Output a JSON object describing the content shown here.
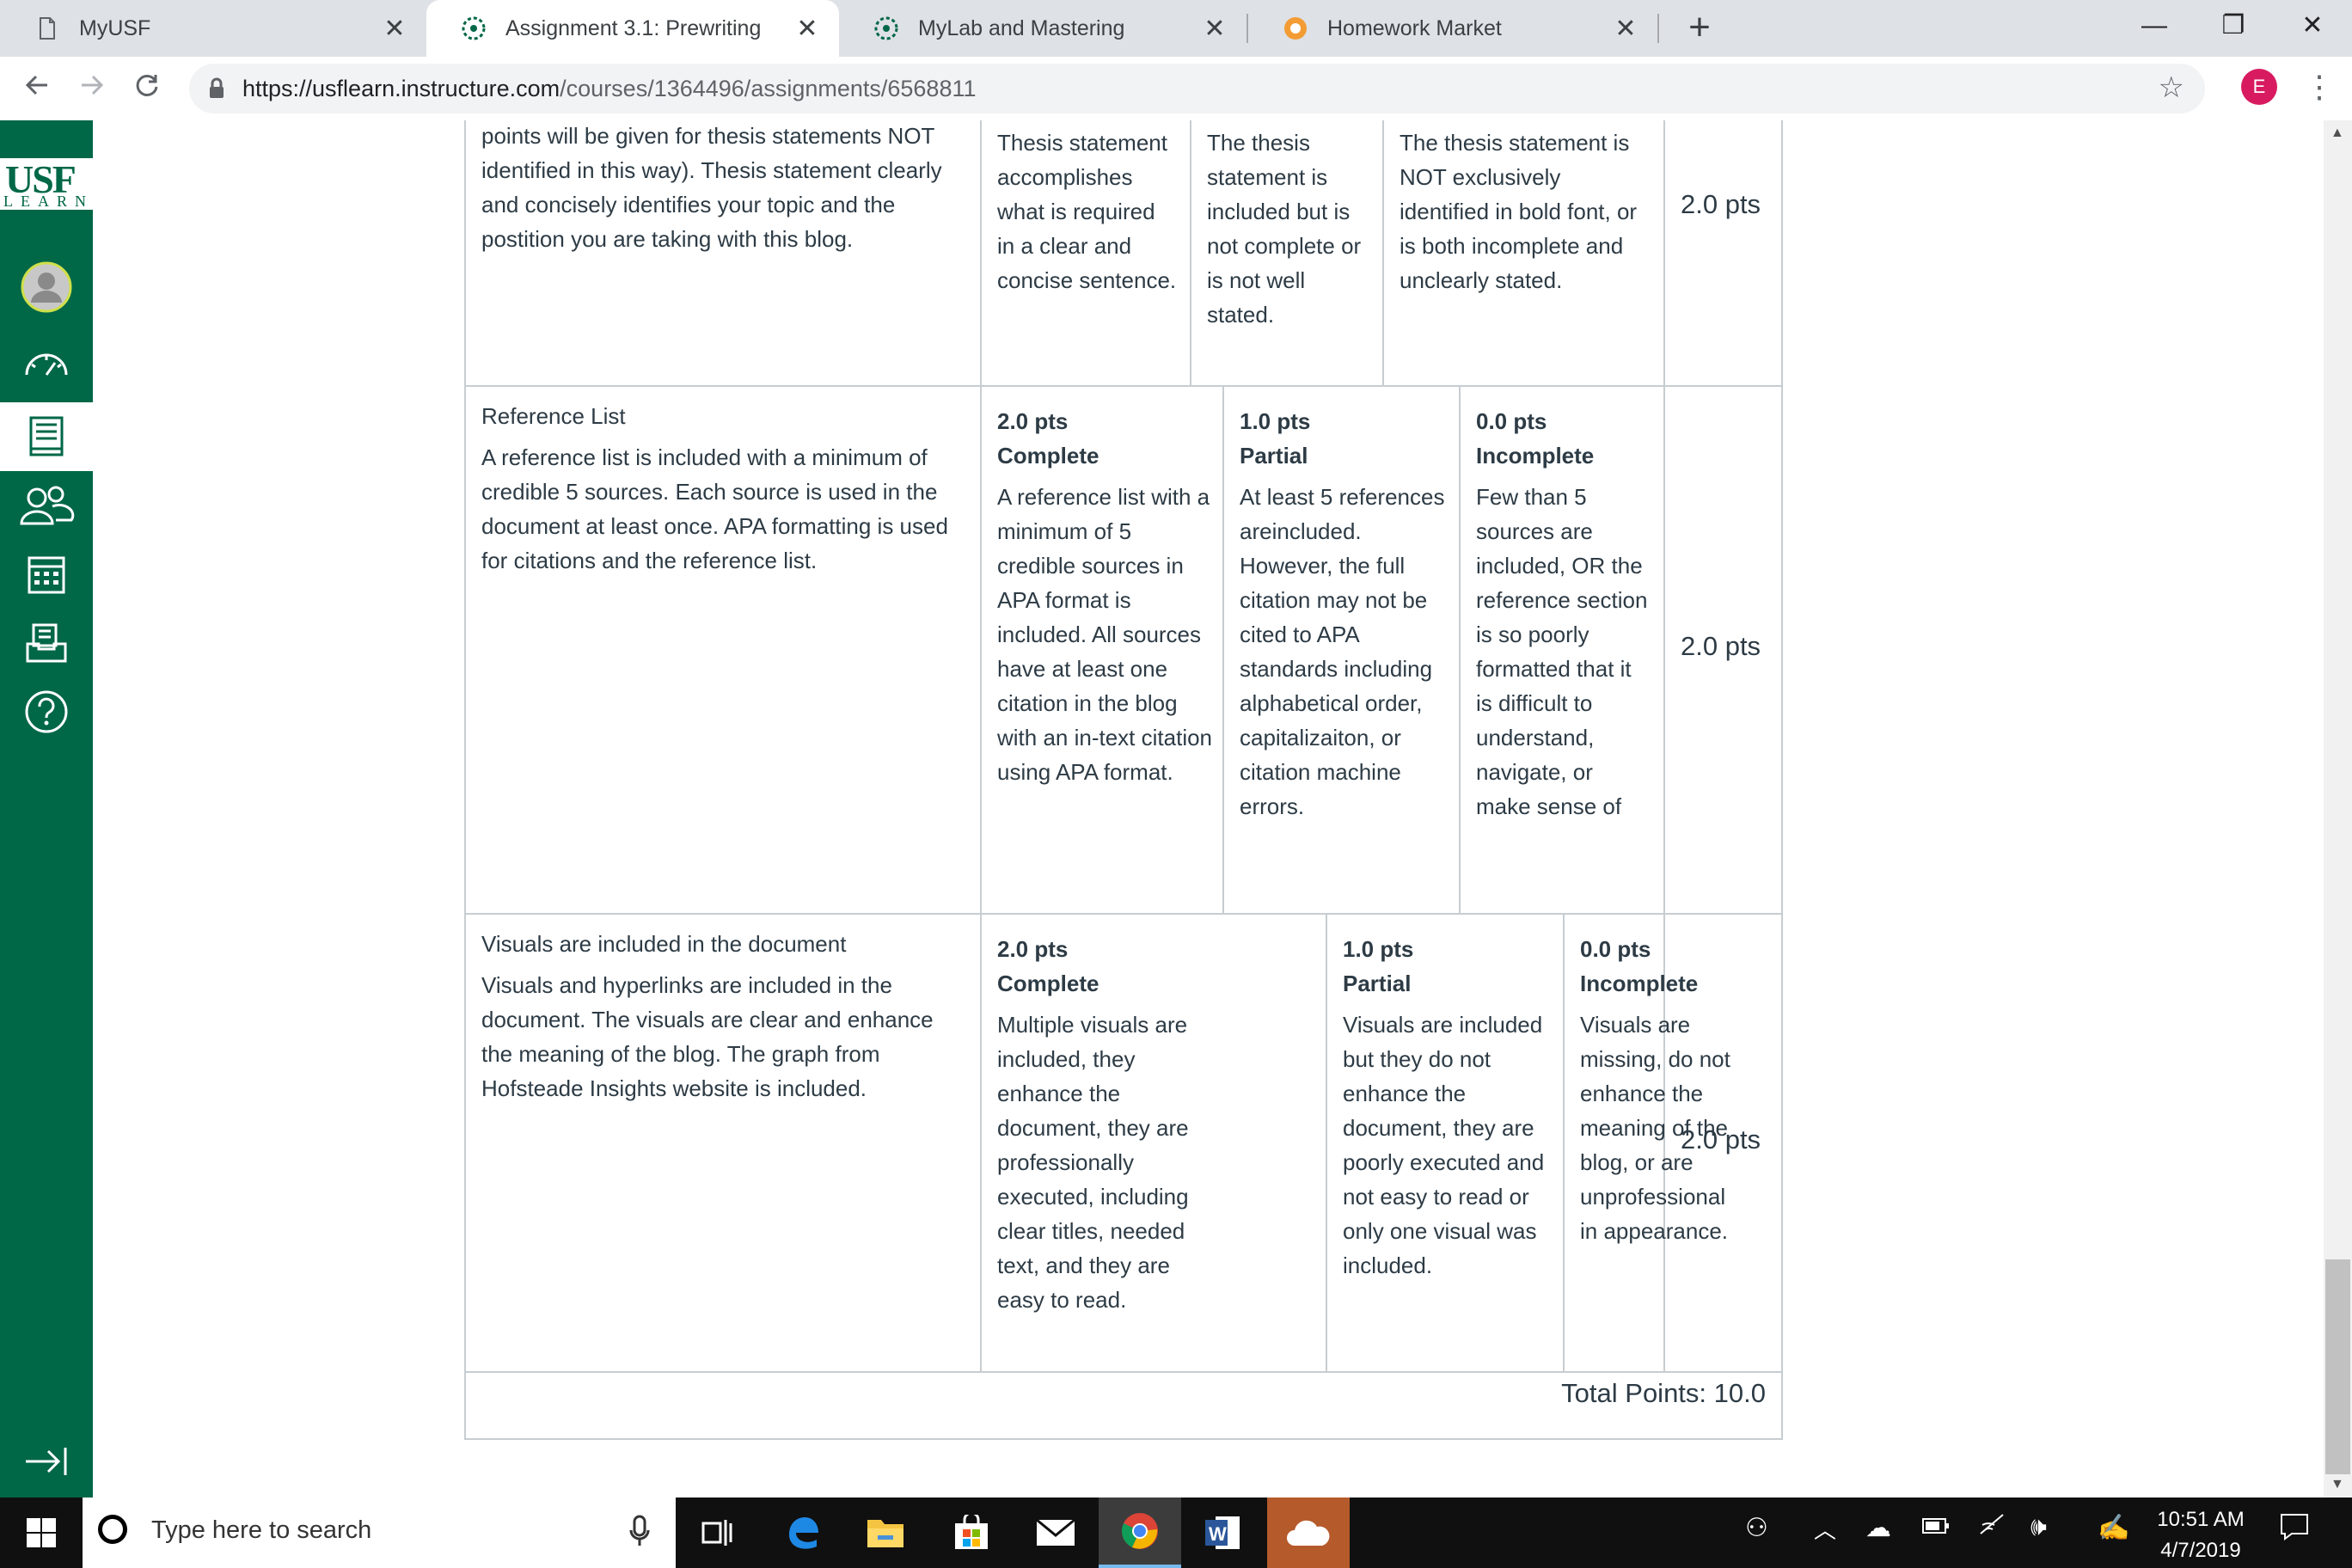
{
  "browser": {
    "tabs": [
      {
        "title": "MyUSF",
        "icon": "page-icon",
        "active": false
      },
      {
        "title": "Assignment 3.1: Prewriting",
        "icon": "canvas-icon",
        "active": true
      },
      {
        "title": "MyLab and Mastering",
        "icon": "canvas-icon",
        "active": false
      },
      {
        "title": "Homework Market",
        "icon": "homework-market-icon",
        "active": false
      }
    ],
    "tab_close": "✕",
    "new_tab": "+",
    "window": {
      "minimize": "—",
      "restore": "❐",
      "close": "✕"
    },
    "url_host": "https://usflearn.instructure.com",
    "url_path": "/courses/1364496/assignments/6568811",
    "profile_initial": "E"
  },
  "nav": {
    "logo_main": "USF",
    "logo_sub": "LEARN",
    "items": [
      "account-icon",
      "dashboard-icon",
      "courses-icon",
      "groups-icon",
      "calendar-icon",
      "inbox-icon",
      "help-icon"
    ],
    "active": "courses-icon"
  },
  "rubric": {
    "rows": [
      {
        "description": "points will be given for thesis statements NOT identified in this way). Thesis statement clearly and concisely identifies your topic and the postition you are taking with this blog.",
        "ratings": [
          {
            "description": "Thesis statement accomplishes what is required in a clear and concise sentence."
          },
          {
            "description": "The thesis statement is included but is not complete or is not well stated."
          },
          {
            "description": "The thesis statement is NOT exclusively identified in bold font, or is both incomplete and unclearly stated."
          }
        ],
        "points": "2.0 pts"
      },
      {
        "title": "Reference List",
        "description": "A reference list is included with a minimum of credible 5 sources. Each source is used in the document at least once. APA formatting is used for citations and the reference list.",
        "ratings": [
          {
            "points": "2.0 pts",
            "title": "Complete",
            "description": "A reference list with a minimum of 5 credible sources in APA format is included. All sources have at least one citation in the blog with an in-text citation using APA format."
          },
          {
            "points": "1.0 pts",
            "title": "Partial",
            "description": "At least 5 references areincluded. However, the full citation may not be cited to APA standards including alphabetical order, capitalizaiton, or citation machine errors."
          },
          {
            "points": "0.0 pts",
            "title": "Incomplete",
            "description": "Few than 5 sources are included, OR the reference section is so poorly formatted that it is difficult to understand, navigate, or make sense of"
          }
        ],
        "points": "2.0 pts"
      },
      {
        "title": "Visuals are included in the document",
        "description": "Visuals and hyperlinks are included in the document. The visuals are clear and enhance the meaning of the blog. The graph from Hofsteade Insights website is included.",
        "ratings": [
          {
            "points": "2.0 pts",
            "title": "Complete",
            "description": "Multiple visuals are included, they enhance the document, they are professionally executed, including clear titles, needed text, and they are easy to read."
          },
          {
            "points": "1.0 pts",
            "title": "Partial",
            "description": "Visuals are included but they do not enhance the document, they are poorly executed and not easy to read or only one visual was included."
          },
          {
            "points": "0.0 pts",
            "title": "Incomplete",
            "description": "Visuals are missing, do not enhance the meaning of the blog, or are unprofessional in appearance."
          }
        ],
        "points": "2.0 pts"
      }
    ],
    "total": "Total Points: 10.0"
  },
  "taskbar": {
    "search_placeholder": "Type here to search",
    "apps": [
      "task-view-icon",
      "edge-icon",
      "file-explorer-icon",
      "store-icon",
      "mail-icon",
      "chrome-icon",
      "word-icon",
      "onedrive-icon"
    ],
    "active_app": "chrome-icon",
    "time": "10:51 AM",
    "date": "4/7/2019"
  },
  "colors": {
    "usf_green": "#006747",
    "canvas_text": "#2d3b45",
    "tab_strip": "#dee1e6",
    "profile": "#d81b60"
  }
}
